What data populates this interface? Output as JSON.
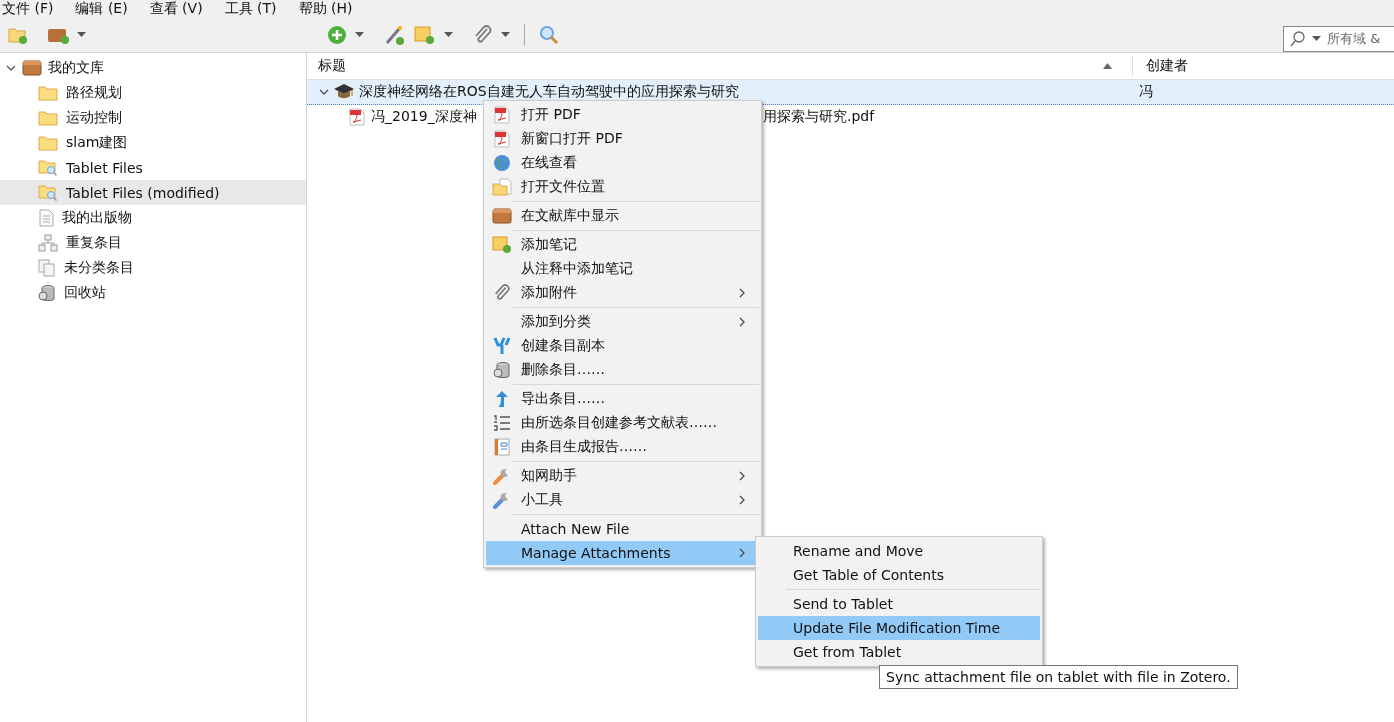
{
  "menubar": [
    "文件 (F)",
    "编辑 (E)",
    "查看 (V)",
    "工具 (T)",
    "帮助 (H)"
  ],
  "search": {
    "placeholder": "所有域 &"
  },
  "sidebar": {
    "root": {
      "label": "我的文库",
      "expanded": true,
      "selected": false,
      "children": [
        {
          "label": "路径规划",
          "kind": "folder",
          "selected": false
        },
        {
          "label": "运动控制",
          "kind": "folder",
          "selected": false
        },
        {
          "label": "slam建图",
          "kind": "folder",
          "selected": false
        },
        {
          "label": "Tablet Files",
          "kind": "saved-search",
          "selected": false
        },
        {
          "label": "Tablet Files (modified)",
          "kind": "saved-search",
          "selected": true
        },
        {
          "label": "我的出版物",
          "kind": "publications",
          "selected": false
        },
        {
          "label": "重复条目",
          "kind": "duplicates",
          "selected": false
        },
        {
          "label": "未分类条目",
          "kind": "unfiled",
          "selected": false
        },
        {
          "label": "回收站",
          "kind": "trash",
          "selected": false
        }
      ]
    }
  },
  "table": {
    "columns": [
      {
        "label": "标题"
      },
      {
        "label": "创建者"
      }
    ],
    "rows": [
      {
        "title": "深度神经网络在ROS自建无人车自动驾驶中的应用探索与研究",
        "creator": "冯",
        "expanded": true,
        "selected": true,
        "children": [
          {
            "title_start": "冯_2019_深度神",
            "title_end": "用探索与研究.pdf"
          }
        ]
      }
    ]
  },
  "context_menu": {
    "items": [
      {
        "kind": "item",
        "label": "打开 PDF",
        "submenu": false,
        "selected": false
      },
      {
        "kind": "item",
        "label": "新窗口打开 PDF",
        "submenu": false,
        "selected": false
      },
      {
        "kind": "item",
        "label": "在线查看",
        "submenu": false,
        "selected": false
      },
      {
        "kind": "item",
        "label": "打开文件位置",
        "submenu": false,
        "selected": false
      },
      {
        "kind": "separator"
      },
      {
        "kind": "item",
        "label": "在文献库中显示",
        "submenu": false,
        "selected": false
      },
      {
        "kind": "separator"
      },
      {
        "kind": "item",
        "label": "添加笔记",
        "submenu": false,
        "selected": false
      },
      {
        "kind": "item",
        "label": "从注释中添加笔记",
        "submenu": false,
        "selected": false
      },
      {
        "kind": "item",
        "label": "添加附件",
        "submenu": true,
        "selected": false
      },
      {
        "kind": "separator"
      },
      {
        "kind": "item",
        "label": "添加到分类",
        "submenu": true,
        "selected": false
      },
      {
        "kind": "item",
        "label": "创建条目副本",
        "submenu": false,
        "selected": false
      },
      {
        "kind": "item",
        "label": "删除条目……",
        "submenu": false,
        "selected": false
      },
      {
        "kind": "separator"
      },
      {
        "kind": "item",
        "label": "导出条目……",
        "submenu": false,
        "selected": false
      },
      {
        "kind": "item",
        "label": "由所选条目创建参考文献表……",
        "submenu": false,
        "selected": false
      },
      {
        "kind": "item",
        "label": "由条目生成报告……",
        "submenu": false,
        "selected": false
      },
      {
        "kind": "separator"
      },
      {
        "kind": "item",
        "label": "知网助手",
        "submenu": true,
        "selected": false
      },
      {
        "kind": "item",
        "label": "小工具",
        "submenu": true,
        "selected": false
      },
      {
        "kind": "separator"
      },
      {
        "kind": "item",
        "label": "Attach New File",
        "submenu": false,
        "selected": false
      },
      {
        "kind": "item",
        "label": "Manage Attachments",
        "submenu": true,
        "selected": true
      }
    ]
  },
  "submenu": {
    "items": [
      {
        "kind": "item",
        "label": "Rename and Move",
        "selected": false
      },
      {
        "kind": "item",
        "label": "Get Table of Contents",
        "selected": false
      },
      {
        "kind": "separator"
      },
      {
        "kind": "item",
        "label": "Send to Tablet",
        "selected": false
      },
      {
        "kind": "item",
        "label": "Update File Modification Time",
        "selected": true
      },
      {
        "kind": "item",
        "label": "Get from Tablet",
        "selected": false
      }
    ]
  },
  "tooltip": {
    "text": "Sync attachment file on tablet with file in Zotero."
  }
}
